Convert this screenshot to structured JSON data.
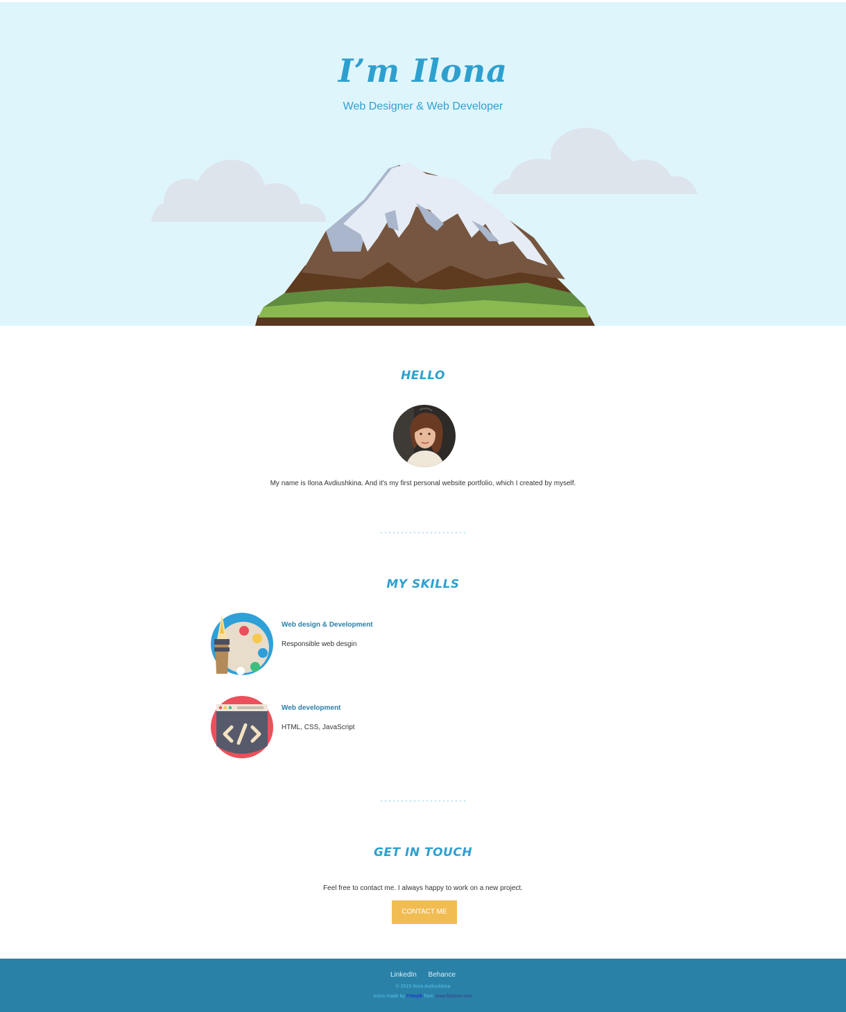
{
  "hero": {
    "title": "I’m Ilona",
    "subtitle": "Web Designer & Web Developer"
  },
  "hello": {
    "title": "HELLO",
    "intro": "My name is Ilona Avdiushkina. And it's my first personal website portfolio, which I created by myself."
  },
  "skills": {
    "title": "MY SKILLS",
    "items": [
      {
        "name": "Web design & Development",
        "description": "Responsible web desgin",
        "icon": "palette-icon"
      },
      {
        "name": "Web development",
        "description": "HTML, CSS, JavaScript",
        "icon": "code-window-icon"
      }
    ]
  },
  "contact": {
    "title": "GET IN TOUCH",
    "text": "Feel free to contact me. I always happy to work on a new project.",
    "button_label": "CONTACT ME"
  },
  "footer": {
    "links": [
      "LinkedIn",
      "Behance"
    ],
    "copyright": "© 2019 Ilona Avdiushkina",
    "credit_prefix": "Icons made by",
    "credit_author": "Freepik",
    "credit_mid": "from",
    "credit_site": "www.flaticon.com"
  },
  "colors": {
    "accent": "#2ea0cf",
    "hero_bg": "#dff5fc",
    "button": "#f1bd52",
    "footer_bg": "#2a81a7"
  }
}
